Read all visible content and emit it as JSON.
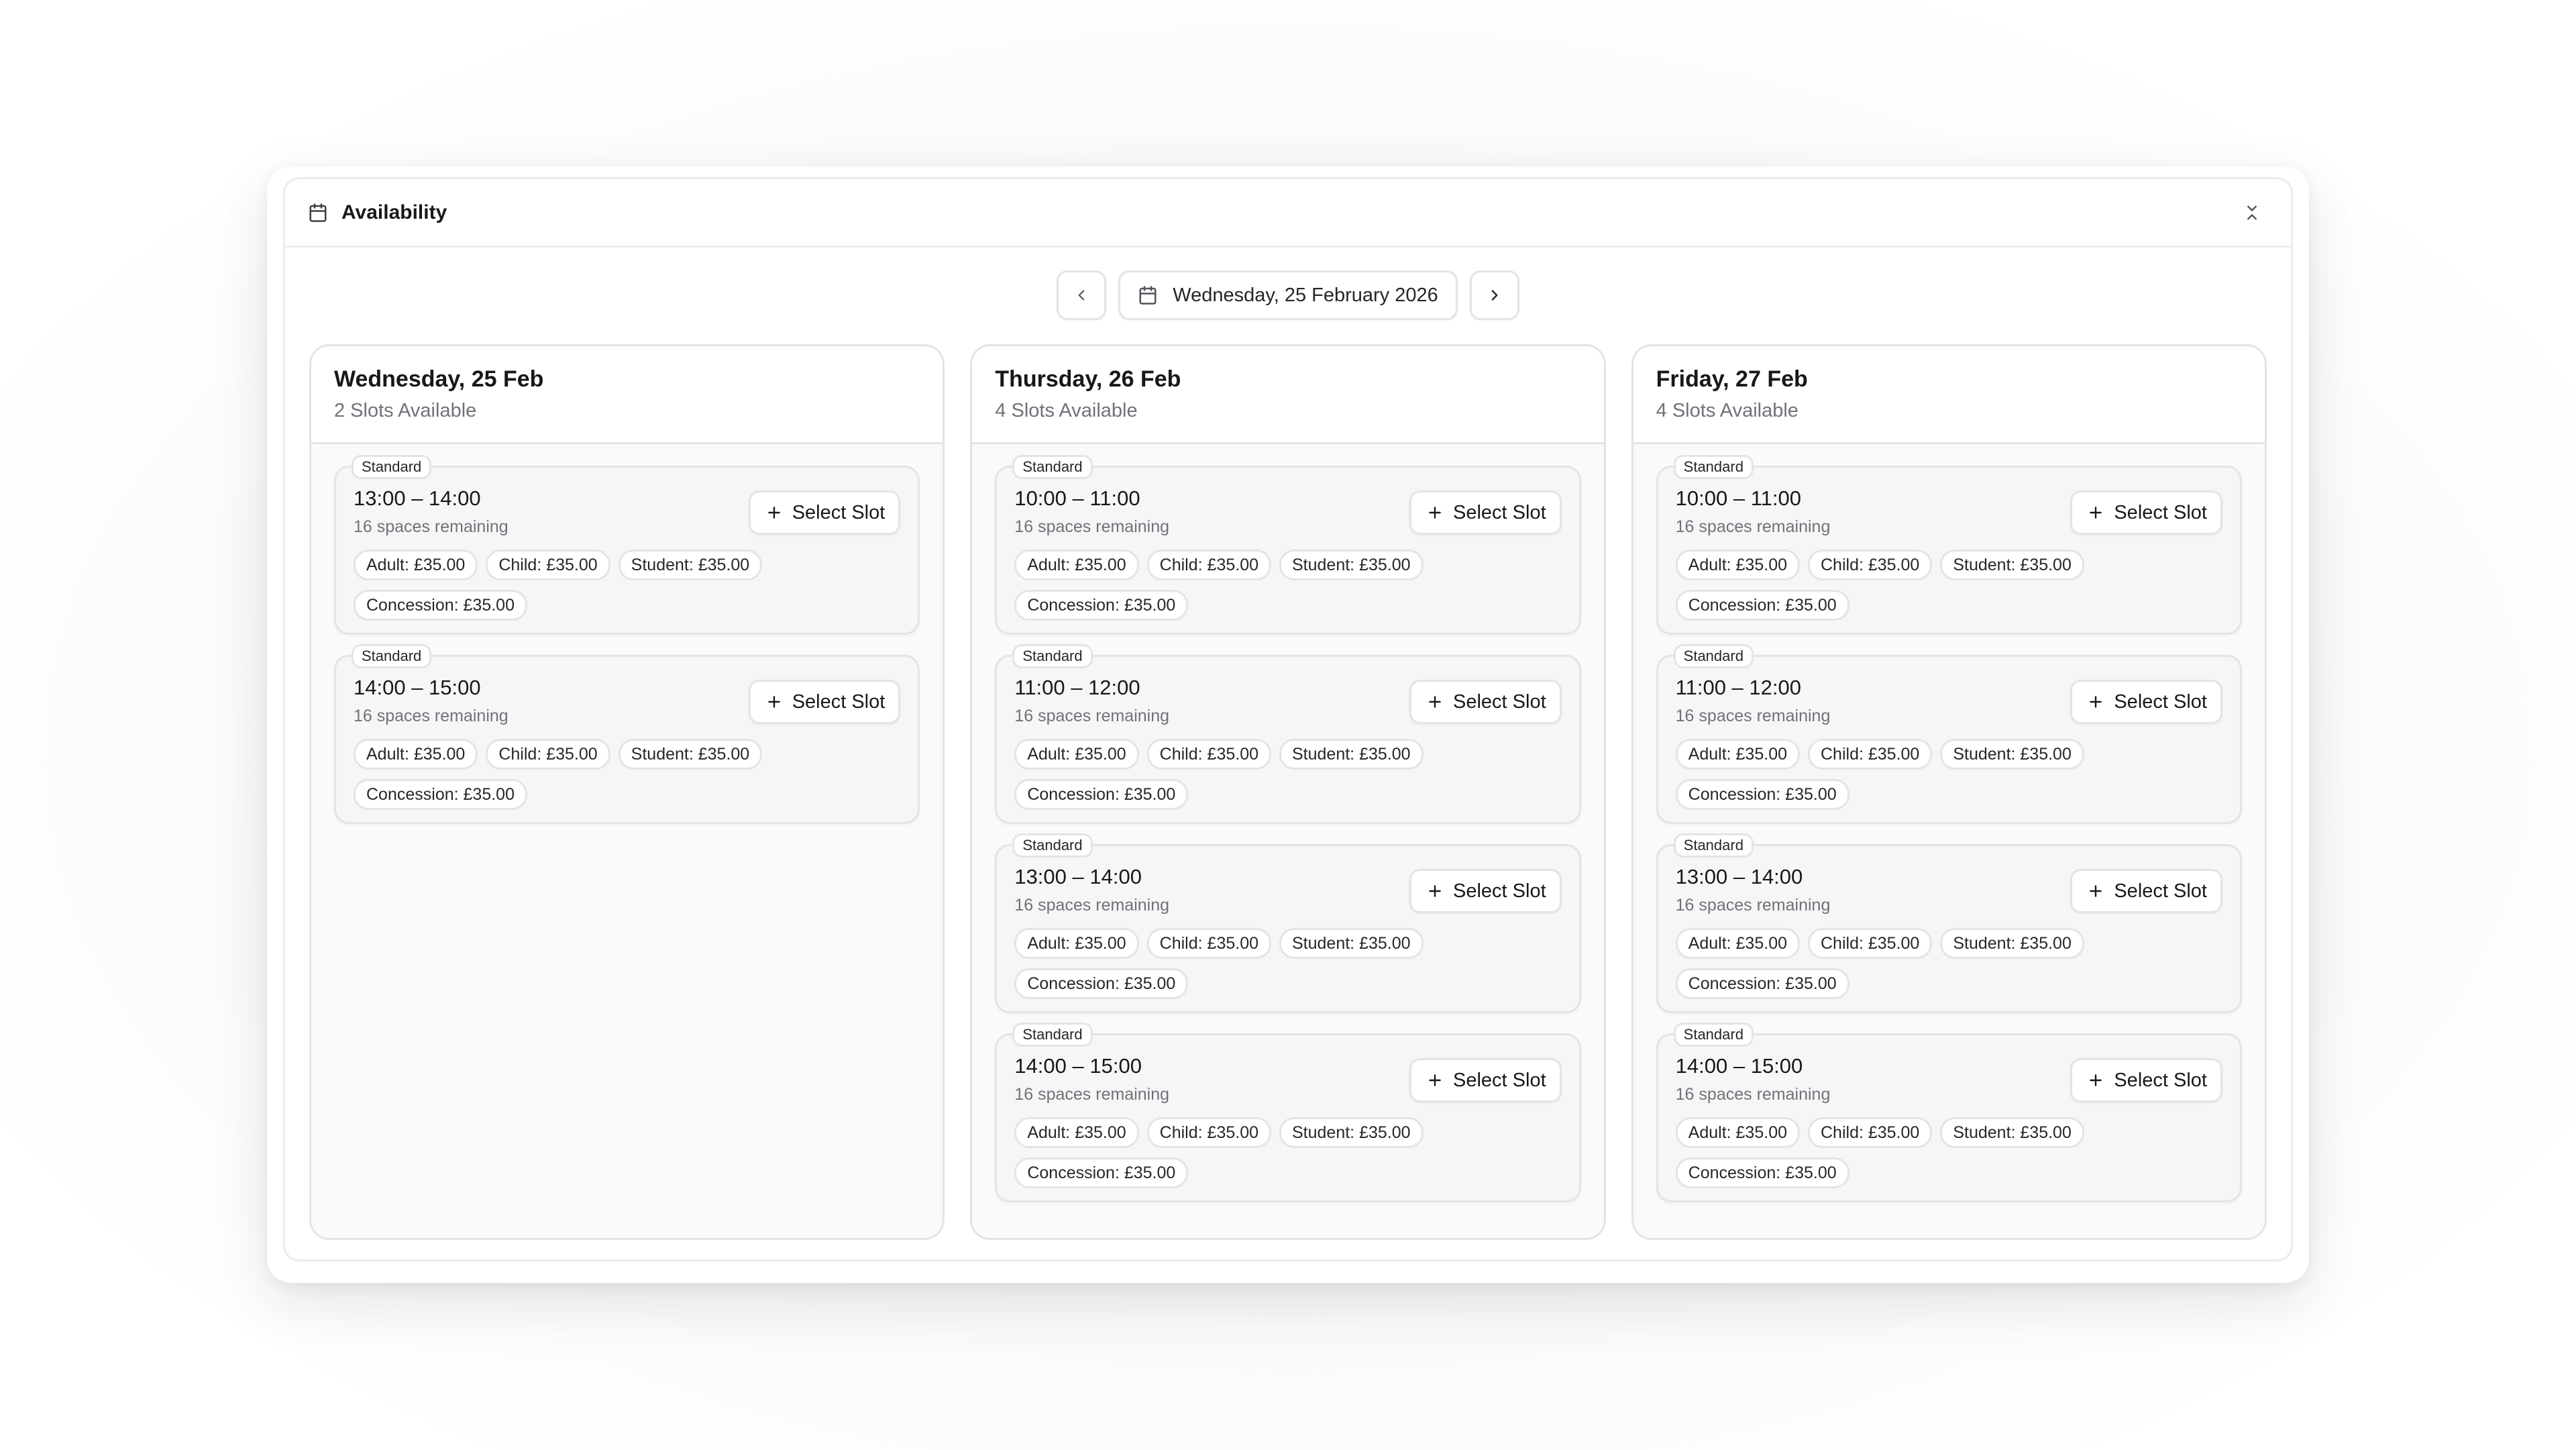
{
  "header": {
    "title": "Availability"
  },
  "date_nav": {
    "current_date": "Wednesday, 25 February 2026"
  },
  "select_label": "Select Slot",
  "days": [
    {
      "title": "Wednesday, 25 Feb",
      "slots_available": "2 Slots Available",
      "slots": [
        {
          "tag": "Standard",
          "time": "13:00 – 14:00",
          "remaining": "16 spaces remaining",
          "prices": [
            "Adult: £35.00",
            "Child: £35.00",
            "Student: £35.00",
            "Concession: £35.00"
          ]
        },
        {
          "tag": "Standard",
          "time": "14:00 – 15:00",
          "remaining": "16 spaces remaining",
          "prices": [
            "Adult: £35.00",
            "Child: £35.00",
            "Student: £35.00",
            "Concession: £35.00"
          ]
        }
      ]
    },
    {
      "title": "Thursday, 26 Feb",
      "slots_available": "4 Slots Available",
      "slots": [
        {
          "tag": "Standard",
          "time": "10:00 – 11:00",
          "remaining": "16 spaces remaining",
          "prices": [
            "Adult: £35.00",
            "Child: £35.00",
            "Student: £35.00",
            "Concession: £35.00"
          ]
        },
        {
          "tag": "Standard",
          "time": "11:00 – 12:00",
          "remaining": "16 spaces remaining",
          "prices": [
            "Adult: £35.00",
            "Child: £35.00",
            "Student: £35.00",
            "Concession: £35.00"
          ]
        },
        {
          "tag": "Standard",
          "time": "13:00 – 14:00",
          "remaining": "16 spaces remaining",
          "prices": [
            "Adult: £35.00",
            "Child: £35.00",
            "Student: £35.00",
            "Concession: £35.00"
          ]
        },
        {
          "tag": "Standard",
          "time": "14:00 – 15:00",
          "remaining": "16 spaces remaining",
          "prices": [
            "Adult: £35.00",
            "Child: £35.00",
            "Student: £35.00",
            "Concession: £35.00"
          ]
        }
      ]
    },
    {
      "title": "Friday, 27 Feb",
      "slots_available": "4 Slots Available",
      "slots": [
        {
          "tag": "Standard",
          "time": "10:00 – 11:00",
          "remaining": "16 spaces remaining",
          "prices": [
            "Adult: £35.00",
            "Child: £35.00",
            "Student: £35.00",
            "Concession: £35.00"
          ]
        },
        {
          "tag": "Standard",
          "time": "11:00 – 12:00",
          "remaining": "16 spaces remaining",
          "prices": [
            "Adult: £35.00",
            "Child: £35.00",
            "Student: £35.00",
            "Concession: £35.00"
          ]
        },
        {
          "tag": "Standard",
          "time": "13:00 – 14:00",
          "remaining": "16 spaces remaining",
          "prices": [
            "Adult: £35.00",
            "Child: £35.00",
            "Student: £35.00",
            "Concession: £35.00"
          ]
        },
        {
          "tag": "Standard",
          "time": "14:00 – 15:00",
          "remaining": "16 spaces remaining",
          "prices": [
            "Adult: £35.00",
            "Child: £35.00",
            "Student: £35.00",
            "Concession: £35.00"
          ]
        }
      ]
    }
  ]
}
